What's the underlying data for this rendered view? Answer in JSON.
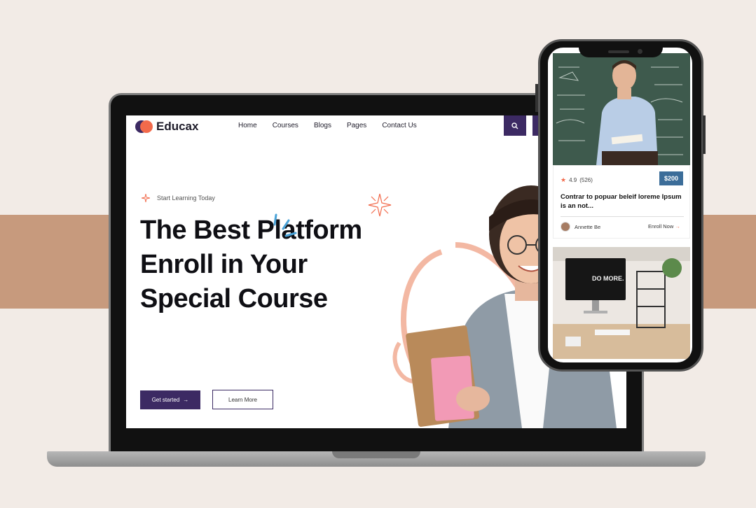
{
  "site": {
    "brand": "Educax",
    "nav": [
      "Home",
      "Courses",
      "Blogs",
      "Pages",
      "Contact Us"
    ],
    "kicker": "Start Learning Today",
    "headline": "The Best Platform Enroll in Your Special Course",
    "primary_button": "Get started",
    "secondary_button": "Learn More"
  },
  "mobile_card": {
    "rating": "4.9",
    "rating_count": "(526)",
    "price": "$200",
    "title": "Contrar to popuar beleif loreme Ipsum is an not...",
    "author": "Annette Be",
    "enroll": "Enroll Now"
  },
  "monitor_text": "DO MORE.",
  "colors": {
    "background": "#f2ebe6",
    "band": "#c79a7d",
    "brand_purple": "#3c2a63",
    "brand_orange": "#f26a4b",
    "price_blue": "#3c6d99"
  },
  "icons": [
    "search-icon",
    "sparkle-icon",
    "arrow-right-icon",
    "star-icon"
  ]
}
